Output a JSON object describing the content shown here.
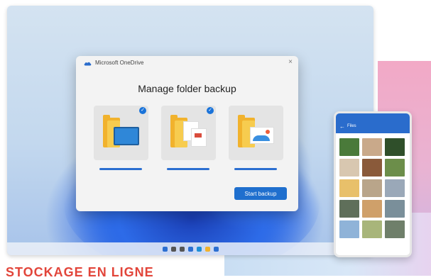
{
  "window": {
    "app_title": "Microsoft OneDrive",
    "close_label": "×",
    "heading": "Manage folder backup",
    "start_button_label": "Start backup",
    "folders": [
      {
        "name": "desktop",
        "checked": true,
        "check_glyph": "✓"
      },
      {
        "name": "documents",
        "checked": true,
        "check_glyph": "✓"
      },
      {
        "name": "pictures",
        "checked": false
      }
    ]
  },
  "phone": {
    "back_label": "←",
    "title": "Files",
    "tile_colors": [
      "#4a7a3a",
      "#c9a98a",
      "#2f4f2a",
      "#d8c7b0",
      "#8a5a3a",
      "#6c8e4a",
      "#e8c06a",
      "#b9a58a",
      "#9aa8b8",
      "#5f6f5a",
      "#cfa06a",
      "#7a8f9a",
      "#8fb3d8",
      "#a8b57a",
      "#6f7f6a"
    ]
  },
  "taskbar": {
    "icons": [
      "start-icon",
      "search-icon",
      "task-view-icon",
      "widgets-icon",
      "edge-icon",
      "explorer-icon",
      "store-icon"
    ],
    "icon_colors": [
      "#2c6fd1",
      "#555",
      "#555",
      "#2c6fd1",
      "#1d8fd6",
      "#f1b22d",
      "#2c6fd1"
    ]
  },
  "watermark": "STOCKAGE EN LIGNE",
  "colors": {
    "accent": "#1f6fce",
    "folder": "#f1b22d",
    "watermark": "#e2453a"
  }
}
